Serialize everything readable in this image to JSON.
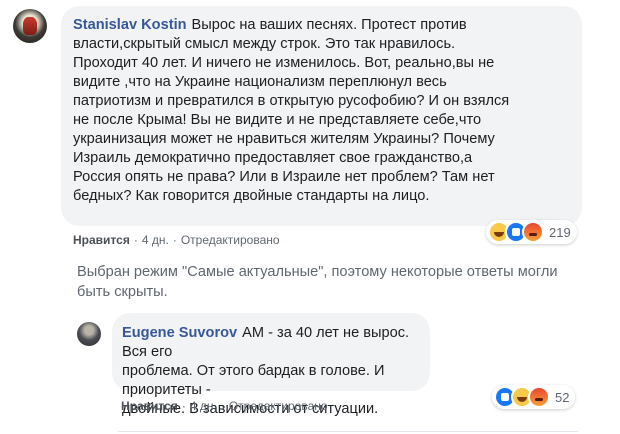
{
  "comment": {
    "author": "Stanislav Kostin",
    "text": "Вырос на ваших песнях. Протест против\nвласти,скрытый смысл между строк. Это так нравилось.\nПроходит 40 лет. И ничего не изменилось. Вот, реально,вы не\nвидите ,что на Украине национализм переплюнул весь\nпатриотизм и превратился в открытую русофобию? И он взялся\nне после Крыма! Вы не видите и не представляете себе,что\nукраинизация может не нравиться жителям Украины? Почему\nИзраиль демократично предоставляет свое гражданство,а\nРоссия опять не права? Или в Израиле нет проблем? Там нет\nбедных? Как говорится двойные стандарты на лицо.",
    "like": "Нравится",
    "time": "4 дн.",
    "edited": "Отредактировано",
    "reaction_count": "219",
    "reactions": [
      "haha-emoji",
      "like-emoji",
      "angry-emoji"
    ]
  },
  "notice": "Выбран режим \"Самые актуальные\", поэтому некоторые ответы могли быть скрыты.",
  "reply": {
    "author": "Eugene Suvorov",
    "text": "АМ - за 40 лет не вырос. Вся его\nпроблема. От этого бардак в голове. И приоритеты -\nдвойные. В зависимости от ситуации.",
    "like": "Нравится",
    "time": "4 дн.",
    "edited": "Отредактировано",
    "reaction_count": "52",
    "reactions": [
      "like-emoji",
      "haha-emoji",
      "angry-emoji"
    ]
  },
  "separator": "·"
}
